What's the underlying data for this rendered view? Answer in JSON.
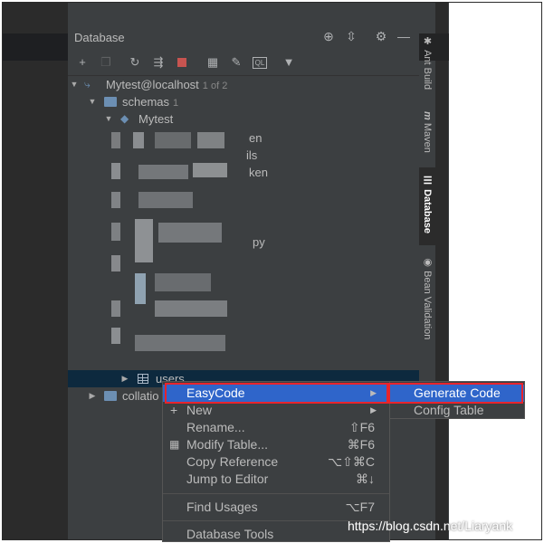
{
  "panel": {
    "title": "Database",
    "header_icons": [
      "crosshair-icon",
      "collapse-icon",
      "gear-icon",
      "minimize-icon"
    ],
    "toolbar_icons": [
      "add-icon",
      "copy-icon",
      "refresh-icon",
      "sync-icon",
      "stop-icon",
      "table-view-icon",
      "edit-icon",
      "sql-console-icon",
      "filter-icon"
    ]
  },
  "tree": {
    "connection": {
      "label": "Mytest@localhost",
      "count": "1 of 2"
    },
    "schemas": {
      "label": "schemas",
      "count": "1"
    },
    "schema": {
      "label": "Mytest"
    },
    "partial_tails": [
      "en",
      "ils",
      "ken",
      "py"
    ],
    "users": {
      "label": "users"
    },
    "collations": {
      "label": "collatio"
    }
  },
  "side_tabs": [
    {
      "label": "Ant Build",
      "icon": "ant-icon"
    },
    {
      "label": "Maven",
      "icon": "maven-icon"
    },
    {
      "label": "Database",
      "icon": "database-icon",
      "active": true
    },
    {
      "label": "Bean Validation",
      "icon": "bean-icon"
    }
  ],
  "context_menu": {
    "items": [
      {
        "label": "EasyCode",
        "shortcut": "",
        "submenu": true,
        "highlighted": true
      },
      {
        "label": "New",
        "shortcut": "",
        "submenu": true
      },
      {
        "label": "Rename...",
        "shortcut": "⇧F6"
      },
      {
        "label": "Modify Table...",
        "shortcut": "⌘F6"
      },
      {
        "label": "Copy Reference",
        "shortcut": "⌥⇧⌘C"
      },
      {
        "label": "Jump to Editor",
        "shortcut": "⌘↓"
      },
      {
        "label": "Find Usages",
        "shortcut": "⌥F7"
      },
      {
        "label": "Database Tools",
        "shortcut": "",
        "submenu": true
      }
    ]
  },
  "submenu": {
    "items": [
      {
        "label": "Generate Code",
        "highlighted": true
      },
      {
        "label": "Config Table"
      }
    ]
  },
  "watermark": "https://blog.csdn.net/Liaryank",
  "colors": {
    "highlight": "#2f65ca",
    "annotation_red": "#e8242c",
    "panel_bg": "#3c3f41"
  }
}
